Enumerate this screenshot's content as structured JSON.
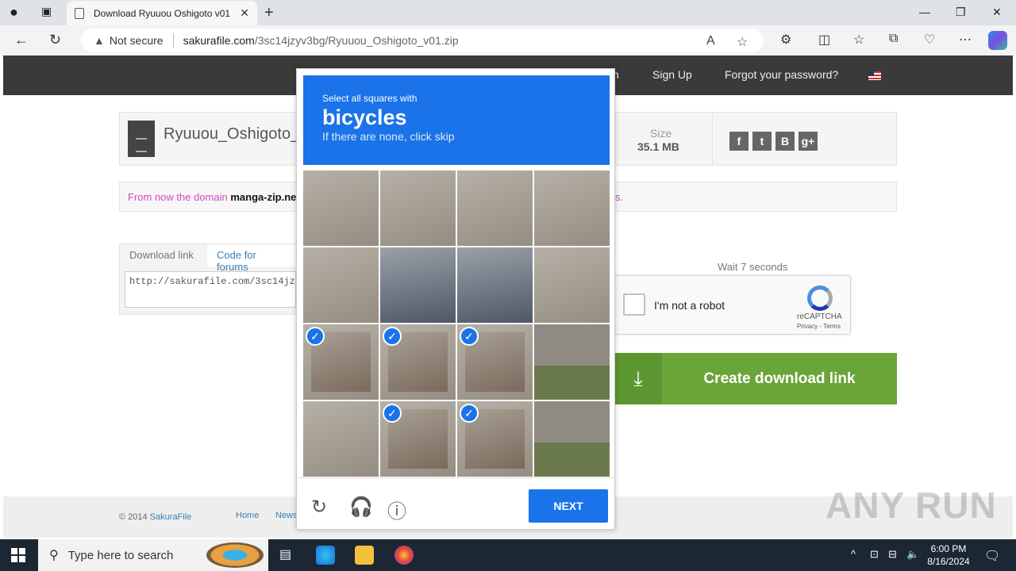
{
  "browser": {
    "tab_title": "Download Ryuuou Oshigoto v01",
    "security_label": "Not secure",
    "url_host": "sakurafile.com",
    "url_path": "/3sc14jzyv3bg/Ryuuou_Oshigoto_v01.zip"
  },
  "site": {
    "nav": {
      "signin_partial": "n",
      "signup": "Sign Up",
      "forgot": "Forgot your password?"
    },
    "file": {
      "name": "Ryuuou_Oshigoto_v",
      "size_label": "Size",
      "size_value": "35.1 MB"
    },
    "social": [
      "f",
      "t",
      "B",
      "g+"
    ],
    "notice": {
      "prefix": "From now the domain ",
      "domain": "manga-zip.net",
      "suffix": "rks."
    },
    "download_tabs": [
      "Download link",
      "Code for forums"
    ],
    "link_value": "http://sakurafile.com/3sc14jzy",
    "wait_text": "Wait 7 seconds",
    "recaptcha": {
      "label": "I'm not a robot",
      "brand": "reCAPTCHA",
      "terms": "Privacy - Terms"
    },
    "create_button": "Create download link",
    "footer": {
      "copyright": "© 2014 ",
      "brand": "SakuraFile",
      "home": "Home",
      "news": "News"
    }
  },
  "captcha": {
    "instruction": "Select all squares with",
    "object": "bicycles",
    "hint": "If there are none, click skip",
    "next_label": "NEXT",
    "selected_tiles": [
      8,
      9,
      10,
      13,
      14
    ]
  },
  "taskbar": {
    "search_placeholder": "Type here to search",
    "time": "6:00 PM",
    "date": "8/16/2024"
  },
  "watermark": "ANY RUN"
}
